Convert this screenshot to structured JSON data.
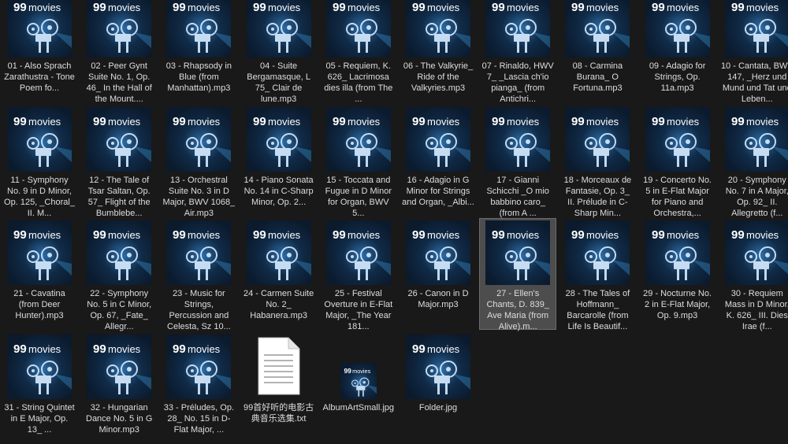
{
  "selected_index": 26,
  "files": [
    {
      "label": "01 - Also Sprach Zarathustra - Tone Poem fo...",
      "type": "mp3"
    },
    {
      "label": "02 - Peer Gynt Suite No. 1, Op. 46_ In the Hall of the Mount....",
      "type": "mp3"
    },
    {
      "label": "03 - Rhapsody in Blue (from Manhattan).mp3",
      "type": "mp3"
    },
    {
      "label": "04 - Suite Bergamasque, L 75_ Clair de lune.mp3",
      "type": "mp3"
    },
    {
      "label": "05 - Requiem, K. 626_ Lacrimosa dies illa (from The ...",
      "type": "mp3"
    },
    {
      "label": "06 - The Valkyrie_ Ride of the Valkyries.mp3",
      "type": "mp3"
    },
    {
      "label": "07 - Rinaldo, HWV 7_ _Lascia ch'io pianga_ (from Antichri...",
      "type": "mp3"
    },
    {
      "label": "08 - Carmina Burana_ O Fortuna.mp3",
      "type": "mp3"
    },
    {
      "label": "09 - Adagio for Strings, Op. 11a.mp3",
      "type": "mp3"
    },
    {
      "label": "10 - Cantata, BWV 147, _Herz und Mund und Tat und Leben...",
      "type": "mp3"
    },
    {
      "label": "11 - Symphony No. 9 in D Minor, Op. 125, _Choral_ II. M...",
      "type": "mp3"
    },
    {
      "label": "12 - The Tale of Tsar Saltan, Op. 57_ Flight of the Bumblebe...",
      "type": "mp3"
    },
    {
      "label": "13 - Orchestral Suite No. 3 in D Major, BWV 1068_ Air.mp3",
      "type": "mp3"
    },
    {
      "label": "14 - Piano Sonata No. 14 in C-Sharp Minor, Op. 2...",
      "type": "mp3"
    },
    {
      "label": "15 - Toccata and Fugue in D Minor for Organ, BWV 5...",
      "type": "mp3"
    },
    {
      "label": "16 - Adagio in G Minor for Strings and Organ, _Albi...",
      "type": "mp3"
    },
    {
      "label": "17 - Gianni Schicchi _O mio babbino caro_ (from A ...",
      "type": "mp3"
    },
    {
      "label": "18 - Morceaux de Fantasie, Op. 3_ II. Prélude in C-Sharp Min...",
      "type": "mp3"
    },
    {
      "label": "19 - Concerto No. 5 in E-Flat Major for Piano and Orchestra,...",
      "type": "mp3"
    },
    {
      "label": "20 - Symphony No. 7 in A Major, Op. 92_ II. Allegretto (f...",
      "type": "mp3"
    },
    {
      "label": "21 - Cavatina (from Deer Hunter).mp3",
      "type": "mp3"
    },
    {
      "label": "22 - Symphony No. 5 in C Minor, Op. 67, _Fate_ Allegr...",
      "type": "mp3"
    },
    {
      "label": "23 - Music for Strings, Percussion and Celesta, Sz 10...",
      "type": "mp3"
    },
    {
      "label": "24 - Carmen Suite No. 2_ Habanera.mp3",
      "type": "mp3"
    },
    {
      "label": "25 - Festival Overture in E-Flat Major, _The Year 181...",
      "type": "mp3"
    },
    {
      "label": "26 - Canon in D Major.mp3",
      "type": "mp3"
    },
    {
      "label": "27 - Ellen's Chants, D. 839_ Ave Maria (from Alive).m...",
      "type": "mp3"
    },
    {
      "label": "28 - The Tales of Hoffmann_ Barcarolle (from Life Is Beautif...",
      "type": "mp3"
    },
    {
      "label": "29 - Nocturne No. 2 in E-Flat Major, Op. 9.mp3",
      "type": "mp3"
    },
    {
      "label": "30 - Requiem Mass in D Minor, K. 626_ III. Dies Irae (f...",
      "type": "mp3"
    },
    {
      "label": "31 - String Quintet in E Major, Op. 13_ ...",
      "type": "mp3"
    },
    {
      "label": "32 - Hungarian Dance No. 5 in G Minor.mp3",
      "type": "mp3"
    },
    {
      "label": "33 - Préludes, Op. 28_ No. 15 in D-Flat Major, ...",
      "type": "mp3"
    },
    {
      "label": "99首好听的电影古典音乐选集.txt",
      "type": "txt"
    },
    {
      "label": "AlbumArtSmall.jpg",
      "type": "jpg-small"
    },
    {
      "label": "Folder.jpg",
      "type": "jpg"
    }
  ],
  "album_art": {
    "brand": "99 movies",
    "brand_number": "99",
    "brand_word": "movies",
    "accent": "#3f9fe0",
    "bg": "#0b1a2c"
  }
}
